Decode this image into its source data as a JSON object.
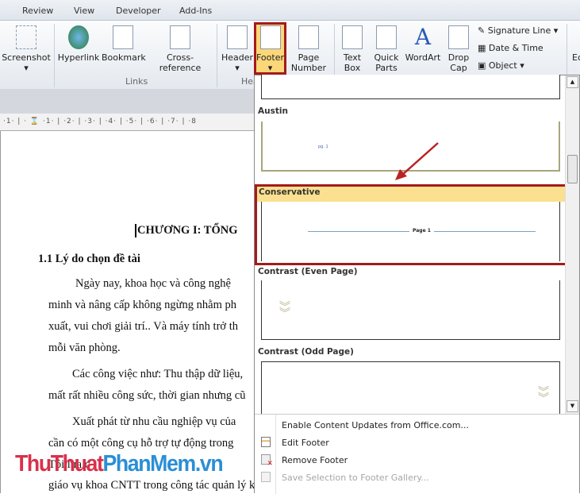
{
  "ribbon_tabs": [
    "Review",
    "View",
    "Developer",
    "Add-Ins"
  ],
  "ribbon": {
    "buttons": {
      "screenshot": "Screenshot",
      "hyperlink": "Hyperlink",
      "bookmark": "Bookmark",
      "cross_reference": "Cross-reference",
      "header": "Header",
      "footer": "Footer",
      "page_number": "Page Number",
      "text_box": "Text Box",
      "quick_parts": "Quick Parts",
      "wordart": "WordArt",
      "drop_cap": "Drop Cap",
      "signature_line": "Signature Line",
      "date_time": "Date & Time",
      "object": "Object",
      "edge": "Ec"
    },
    "groups": {
      "links": "Links",
      "header_footer": "Hea"
    },
    "highlight_color": "#a31b1b"
  },
  "ruler": "·1· | · ⌛ ·1· | ·2· | ·3· | ·4· | ·5· | ·6· | ·7· | ·8",
  "document": {
    "chapter_title": "CHƯƠNG I: TỔNG",
    "section_heading": "1.1 Lý do chọn đề tài",
    "lines": [
      "Ngày nay, khoa học và công nghệ",
      "minh và nâng cấp không ngừng nhằm ph",
      "xuất, vui chơi giải trí.. Và máy tính trở th",
      "mỗi văn phòng.",
      "Các công việc như: Thu thập dữ liệu,",
      "mất rất nhiều công sức, thời gian nhưng cũ",
      "Xuất phát từ nhu cầu nghiệp vụ của",
      "cần có một công cụ hỗ trợ tự động trong",
      "Tôi                                              lựa c",
      "giáo vụ khoa CNTT trong công tác quản lý kế hoạch giáo viên và quản lý điểm"
    ]
  },
  "gallery": {
    "items": [
      {
        "label": "Austin",
        "preview_text": "pg. 1"
      },
      {
        "label": "Conservative",
        "preview_text": "Page 1",
        "selected": true
      },
      {
        "label": "Contrast (Even Page)"
      },
      {
        "label": "Contrast (Odd Page)"
      }
    ],
    "selected_color": "#fbe08f"
  },
  "menu": [
    {
      "label": "Enable Content Updates from Office.com...",
      "enabled": true
    },
    {
      "label": "Edit Footer",
      "icon": "edit-footer-icon",
      "enabled": true
    },
    {
      "label": "Remove Footer",
      "icon": "remove-footer-icon",
      "enabled": true
    },
    {
      "label": "Save Selection to Footer Gallery...",
      "icon": "save-selection-icon",
      "enabled": false
    }
  ],
  "watermark": {
    "part1": "ThuThuat",
    "part2": "PhanMem",
    ".vn": ".vn",
    "part3": ".vn"
  }
}
